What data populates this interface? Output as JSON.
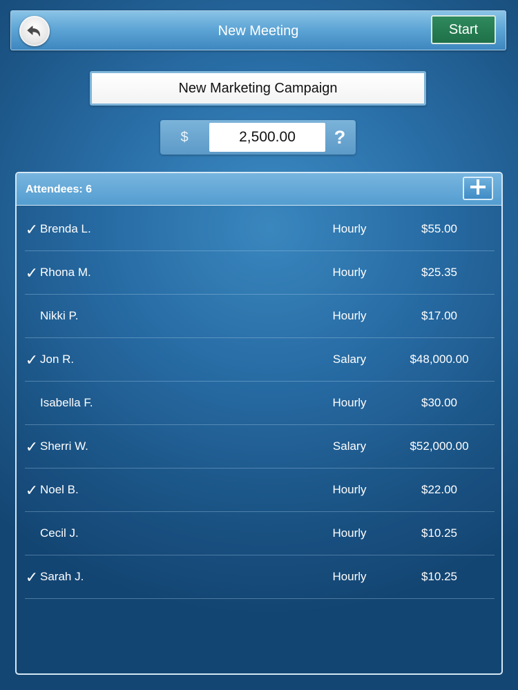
{
  "header": {
    "title": "New Meeting",
    "start_label": "Start"
  },
  "meeting": {
    "name": "New Marketing Campaign"
  },
  "budget": {
    "currency_symbol": "$",
    "value": "2,500.00",
    "help_label": "?"
  },
  "attendees": {
    "label": "Attendees: 6",
    "rows": [
      {
        "check": "✓",
        "name": "Brenda L.",
        "type": "Hourly",
        "rate": "$55.00"
      },
      {
        "check": "✓",
        "name": "Rhona M.",
        "type": "Hourly",
        "rate": "$25.35"
      },
      {
        "check": "",
        "name": "Nikki P.",
        "type": "Hourly",
        "rate": "$17.00"
      },
      {
        "check": "✓",
        "name": "Jon R.",
        "type": "Salary",
        "rate": "$48,000.00"
      },
      {
        "check": "",
        "name": "Isabella F.",
        "type": "Hourly",
        "rate": "$30.00"
      },
      {
        "check": "✓",
        "name": "Sherri W.",
        "type": "Salary",
        "rate": "$52,000.00"
      },
      {
        "check": "✓",
        "name": "Noel B.",
        "type": "Hourly",
        "rate": "$22.00"
      },
      {
        "check": "",
        "name": "Cecil J.",
        "type": "Hourly",
        "rate": "$10.25"
      },
      {
        "check": "✓",
        "name": "Sarah J.",
        "type": "Hourly",
        "rate": "$10.25"
      }
    ]
  },
  "icons": {
    "back": "back-arrow-icon",
    "add": "plus-icon",
    "checked": "checkmark-icon"
  },
  "colors": {
    "start_button": "#1f7048",
    "background": "#2a6fa8",
    "panel_header": "#549dd0"
  }
}
